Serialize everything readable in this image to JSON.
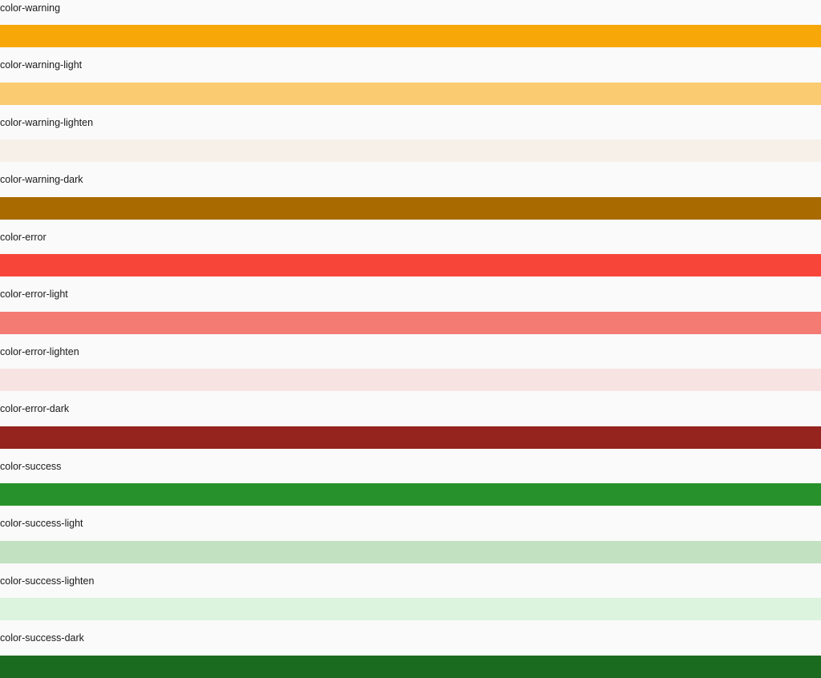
{
  "swatches": [
    {
      "label": "color-warning",
      "color": "#f7a707"
    },
    {
      "label": "color-warning-light",
      "color": "#facb70"
    },
    {
      "label": "color-warning-lighten",
      "color": "#f6f0e8"
    },
    {
      "label": "color-warning-dark",
      "color": "#a96a00"
    },
    {
      "label": "color-error",
      "color": "#f74639"
    },
    {
      "label": "color-error-light",
      "color": "#f37b74"
    },
    {
      "label": "color-error-lighten",
      "color": "#f7e3e1"
    },
    {
      "label": "color-error-dark",
      "color": "#95241f"
    },
    {
      "label": "color-success",
      "color": "#27922b"
    },
    {
      "label": "color-success-light",
      "color": "#c1e1c1"
    },
    {
      "label": "color-success-lighten",
      "color": "#dcf3dd"
    },
    {
      "label": "color-success-dark",
      "color": "#1a6b1f"
    }
  ]
}
